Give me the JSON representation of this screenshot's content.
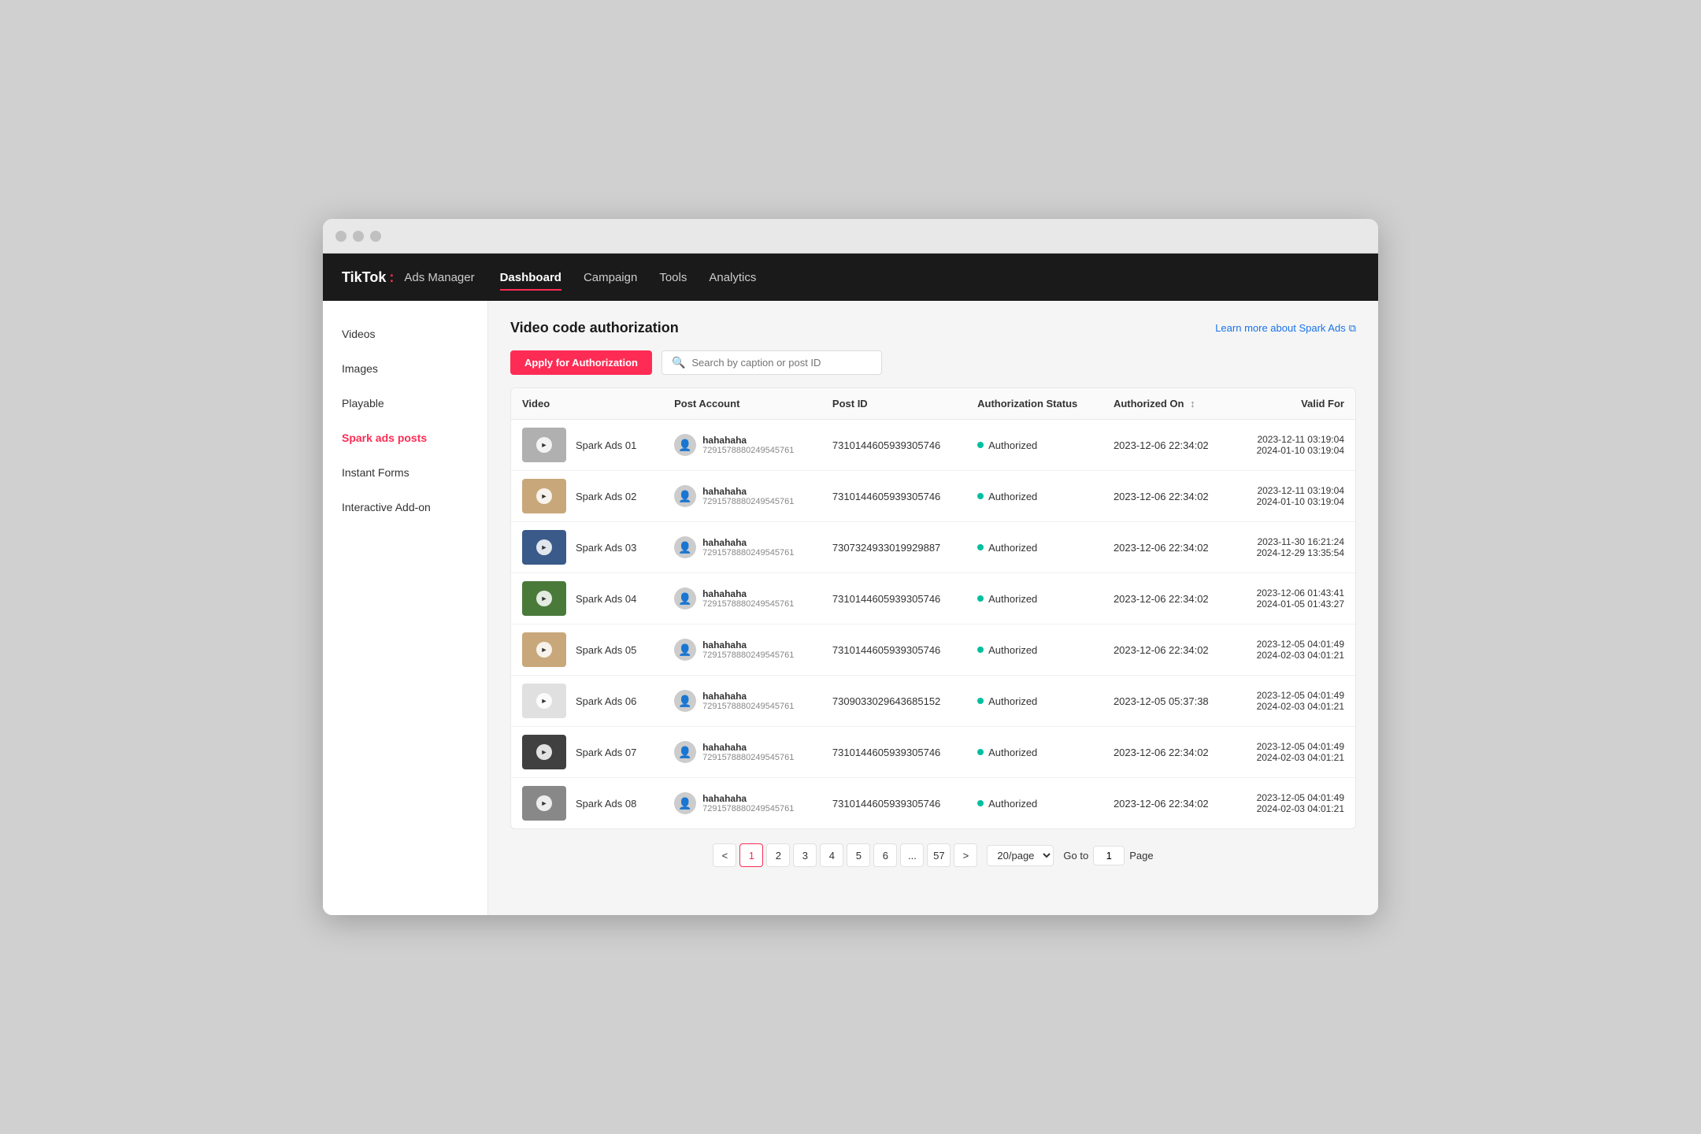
{
  "window": {
    "title": "TikTok Ads Manager"
  },
  "topnav": {
    "logo": "TikTok",
    "logo_colon": ":",
    "logo_sub": "Ads Manager",
    "items": [
      {
        "label": "Dashboard",
        "active": true
      },
      {
        "label": "Campaign",
        "active": false
      },
      {
        "label": "Tools",
        "active": false
      },
      {
        "label": "Analytics",
        "active": false
      }
    ]
  },
  "sidebar": {
    "items": [
      {
        "label": "Videos",
        "active": false
      },
      {
        "label": "Images",
        "active": false
      },
      {
        "label": "Playable",
        "active": false
      },
      {
        "label": "Spark ads posts",
        "active": true
      },
      {
        "label": "Instant Forms",
        "active": false
      },
      {
        "label": "Interactive Add-on",
        "active": false
      }
    ]
  },
  "content": {
    "page_title": "Video code authorization",
    "learn_more": "Learn more about Spark Ads",
    "apply_btn": "Apply for Authorization",
    "search_placeholder": "Search by caption or post ID",
    "table": {
      "headers": [
        "Video",
        "Post Account",
        "Post ID",
        "Authorization Status",
        "Authorized On",
        "Valid For"
      ],
      "rows": [
        {
          "thumb_bg": "thumb-bg-gray",
          "video_name": "Spark Ads 01",
          "account_name": "hahahaha",
          "account_id": "7291578880249545761",
          "post_id": "7310144605939305746",
          "status": "Authorized",
          "authorized_on": "2023-12-06 22:34:02",
          "valid_from": "2023-12-11 03:19:04",
          "valid_to": "2024-01-10 03:19:04"
        },
        {
          "thumb_bg": "thumb-bg-tan",
          "video_name": "Spark Ads 02",
          "account_name": "hahahaha",
          "account_id": "7291578880249545761",
          "post_id": "7310144605939305746",
          "status": "Authorized",
          "authorized_on": "2023-12-06 22:34:02",
          "valid_from": "2023-12-11 03:19:04",
          "valid_to": "2024-01-10 03:19:04"
        },
        {
          "thumb_bg": "thumb-bg-blue",
          "video_name": "Spark Ads 03",
          "account_name": "hahahaha",
          "account_id": "7291578880249545761",
          "post_id": "7307324933019929887",
          "status": "Authorized",
          "authorized_on": "2023-12-06 22:34:02",
          "valid_from": "2023-11-30 16:21:24",
          "valid_to": "2024-12-29 13:35:54"
        },
        {
          "thumb_bg": "thumb-bg-green",
          "video_name": "Spark Ads 04",
          "account_name": "hahahaha",
          "account_id": "7291578880249545761",
          "post_id": "7310144605939305746",
          "status": "Authorized",
          "authorized_on": "2023-12-06 22:34:02",
          "valid_from": "2023-12-06 01:43:41",
          "valid_to": "2024-01-05 01:43:27"
        },
        {
          "thumb_bg": "thumb-bg-tan",
          "video_name": "Spark Ads 05",
          "account_name": "hahahaha",
          "account_id": "7291578880249545761",
          "post_id": "7310144605939305746",
          "status": "Authorized",
          "authorized_on": "2023-12-06 22:34:02",
          "valid_from": "2023-12-05 04:01:49",
          "valid_to": "2024-02-03 04:01:21"
        },
        {
          "thumb_bg": "thumb-bg-white",
          "video_name": "Spark Ads 06",
          "account_name": "hahahaha",
          "account_id": "7291578880249545761",
          "post_id": "7309033029643685152",
          "status": "Authorized",
          "authorized_on": "2023-12-05 05:37:38",
          "valid_from": "2023-12-05 04:01:49",
          "valid_to": "2024-02-03 04:01:21"
        },
        {
          "thumb_bg": "thumb-bg-dark",
          "video_name": "Spark Ads 07",
          "account_name": "hahahaha",
          "account_id": "7291578880249545761",
          "post_id": "7310144605939305746",
          "status": "Authorized",
          "authorized_on": "2023-12-06 22:34:02",
          "valid_from": "2023-12-05 04:01:49",
          "valid_to": "2024-02-03 04:01:21"
        },
        {
          "thumb_bg": "thumb-bg-scale",
          "video_name": "Spark Ads 08",
          "account_name": "hahahaha",
          "account_id": "7291578880249545761",
          "post_id": "7310144605939305746",
          "status": "Authorized",
          "authorized_on": "2023-12-06 22:34:02",
          "valid_from": "2023-12-05 04:01:49",
          "valid_to": "2024-02-03 04:01:21"
        }
      ]
    },
    "pagination": {
      "prev": "<",
      "next": ">",
      "pages": [
        "1",
        "2",
        "3",
        "4",
        "5",
        "6",
        "...",
        "57"
      ],
      "current": "1",
      "per_page": "20/page",
      "goto_label": "Go to",
      "goto_value": "1",
      "page_label": "Page"
    }
  }
}
